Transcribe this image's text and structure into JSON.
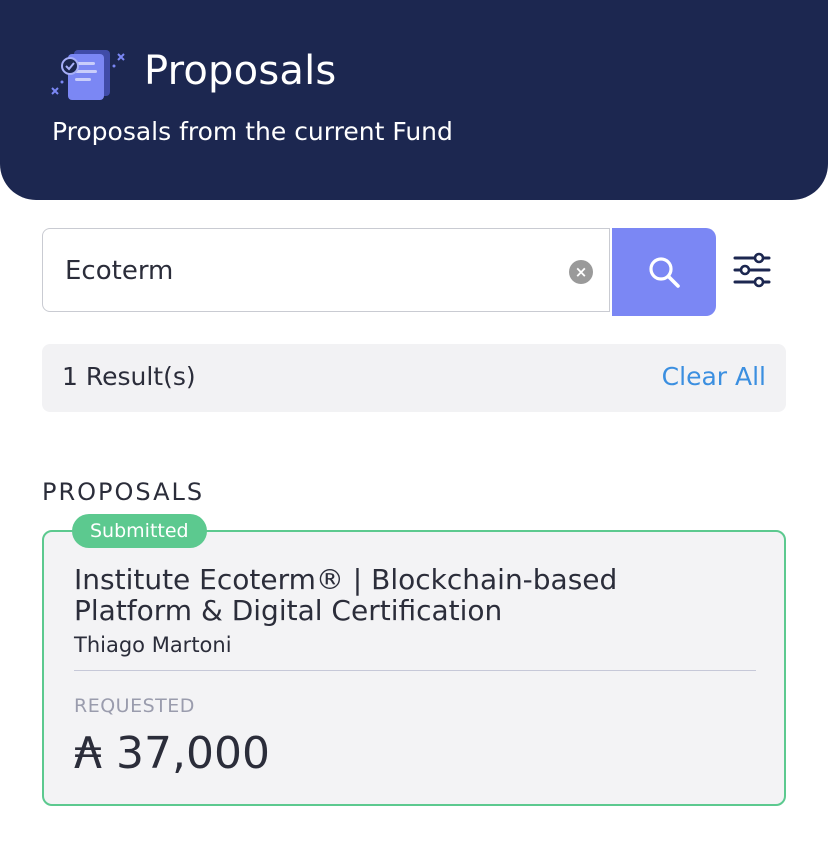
{
  "header": {
    "title": "Proposals",
    "subtitle": "Proposals from the current Fund",
    "icon": "proposals-document-icon",
    "background_color": "#1c2750"
  },
  "search": {
    "value": "Ecoterm",
    "clear_icon": "x-icon",
    "search_icon": "search-icon",
    "filter_icon": "filter-sliders-icon",
    "button_color": "#7b87f4"
  },
  "results": {
    "count_text": "1 Result(s)",
    "clear_all_label": "Clear All"
  },
  "section": {
    "heading": "PROPOSALS"
  },
  "proposals": [
    {
      "status": "Submitted",
      "status_color": "#5cc98f",
      "title": "Institute Ecoterm® | Blockchain-based Platform & Digital Certification",
      "author": "Thiago Martoni",
      "requested_label": "REQUESTED",
      "amount": "₳ 37,000"
    }
  ]
}
